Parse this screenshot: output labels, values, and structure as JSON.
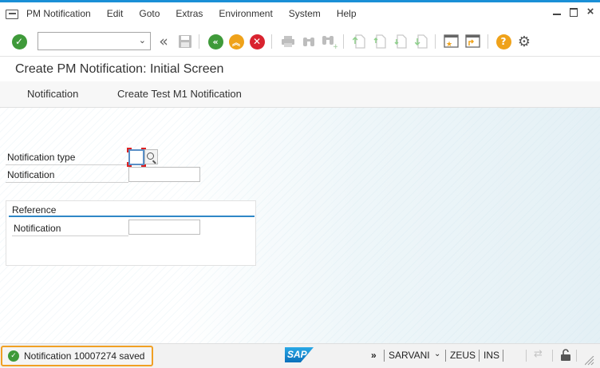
{
  "menubar": {
    "items": [
      {
        "label": "PM Notification"
      },
      {
        "label": "Edit"
      },
      {
        "label": "Goto"
      },
      {
        "label": "Extras"
      },
      {
        "label": "Environment"
      },
      {
        "label": "System"
      },
      {
        "label": "Help"
      }
    ]
  },
  "toolbar": {
    "command_field_value": "",
    "enter_icon": "check-circle-icon",
    "back_icon": "double-chevron-left-icon",
    "save_icon": "floppy-disk-icon",
    "nav_back_icon": "green-back-icon",
    "nav_exit_icon": "orange-up-icon",
    "nav_cancel_icon": "red-cancel-icon",
    "print_icon": "printer-icon",
    "find_icon": "binoculars-icon",
    "find_next_icon": "binoculars-plus-icon",
    "first_page_icon": "first-page-icon",
    "prev_page_icon": "previous-page-icon",
    "next_page_icon": "next-page-icon",
    "last_page_icon": "last-page-icon",
    "new_session_icon": "new-session-icon",
    "shortcut_icon": "create-shortcut-icon",
    "help_icon": "question-icon",
    "settings_icon": "gear-icon",
    "colors": {
      "green": "#3f9a3a",
      "orange": "#efa21a",
      "red": "#d9232f"
    }
  },
  "title": "Create PM Notification: Initial Screen",
  "app_toolbar": {
    "buttons": [
      {
        "label": "Notification"
      },
      {
        "label": "Create Test M1 Notification"
      }
    ]
  },
  "form": {
    "notification_type_label": "Notification type",
    "notification_type_value": "",
    "notification_label": "Notification",
    "notification_value": "",
    "reference_group": {
      "title": "Reference",
      "notification_label": "Notification",
      "notification_value": ""
    }
  },
  "statusbar": {
    "message": "Notification 10007274 saved",
    "message_type": "success",
    "logo": "SAP",
    "expand": "»",
    "user": "SARVANI",
    "system": "ZEUS",
    "mode": "INS",
    "highlight_color": "#f0a024"
  }
}
